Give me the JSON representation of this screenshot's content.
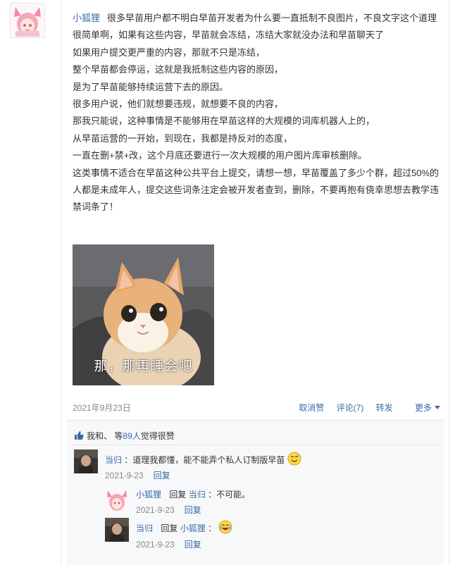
{
  "post": {
    "author": "小狐狸",
    "lines": [
      "很多早苗用户都不明白早苗开发者为什么要一直抵制不良图片，不良文字这个道理很简单啊，如果有这些内容，早苗就会冻结，冻结大家就没办法和早苗聊天了",
      "如果用户提交更严重的内容，那就不只是冻结，",
      "整个早苗都会停运，这就是我抵制这些内容的原因，",
      "是为了早苗能够持续运营下去的原因。",
      "很多用户说，他们就想要违规，就想要不良的内容，",
      "那我只能说，这种事情是不能够用在早苗这样的大规模的词库机器人上的，",
      "从早苗运营的一开始，到现在，我都是持反对的态度，",
      "一直在删+禁+改，这个月底还要进行一次大规模的用户图片库审核删除。",
      "这类事情不适合在早苗这种公共平台上提交，请想一想，早苗覆盖了多少个群，超过50%的人都是未成年人，提交这些词条注定会被开发者查到，删除，不要再抱有侥幸思想去教学违禁词条了！"
    ],
    "image_caption": "那，那再睡会吧",
    "date": "2021年9月23日",
    "actions": {
      "unlike": "取消赞",
      "comments": "评论(7)",
      "repost": "转发",
      "more": "更多"
    }
  },
  "likes": {
    "prefix": "我和、 等",
    "count": "89人",
    "suffix": "觉得很赞"
  },
  "comments": [
    {
      "author": "当归",
      "text": "：道理我都懂，能不能弄个私人订制版早苗",
      "date": "2021-9-23",
      "reply_label": "回复"
    },
    {
      "author": "小狐狸",
      "reply_word": "回复",
      "reply_to": "当归",
      "text": "：不可能。",
      "date": "2021-9-23",
      "reply_label": "回复"
    },
    {
      "author": "当归",
      "reply_word": "回复",
      "reply_to": "小狐狸",
      "text": "：",
      "date": "2021-9-23",
      "reply_label": "回复"
    }
  ],
  "colors": {
    "link": "#3a6aa6",
    "muted": "#888888",
    "comment_bg": "#f7f8fa"
  }
}
